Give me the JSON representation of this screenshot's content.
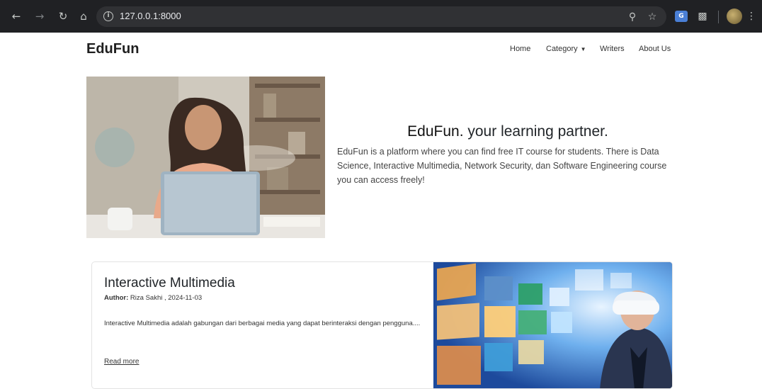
{
  "browser": {
    "url": "127.0.0.1:8000",
    "icons": {
      "back": "arrow-left-icon",
      "forward": "arrow-right-icon",
      "reload": "reload-icon",
      "home": "home-icon",
      "site_info": "info-icon",
      "zoom": "zoom-icon",
      "bookmark": "star-icon",
      "translate": "translate-icon",
      "extensions": "puzzle-icon",
      "menu": "kebab-menu-icon"
    }
  },
  "nav": {
    "brand": "EduFun",
    "items": [
      {
        "label": "Home"
      },
      {
        "label": "Category"
      },
      {
        "label": "Writers"
      },
      {
        "label": "About Us"
      }
    ]
  },
  "hero": {
    "title_em": "EduFun.",
    "title_rest": " your learning partner.",
    "text": "EduFun is a platform where you can find free IT course for students. There is Data Science, Interactive Multimedia, Network Security, dan Software Engineering course you can access freely!"
  },
  "course": {
    "title": "Interactive Multimedia",
    "author_label": "Author:",
    "author_value": " Riza Sakhi , 2024-11-03",
    "description": "Interactive Multimedia adalah gabungan dari berbagai media yang dapat berinteraksi dengan pengguna....",
    "link": "Read more"
  }
}
